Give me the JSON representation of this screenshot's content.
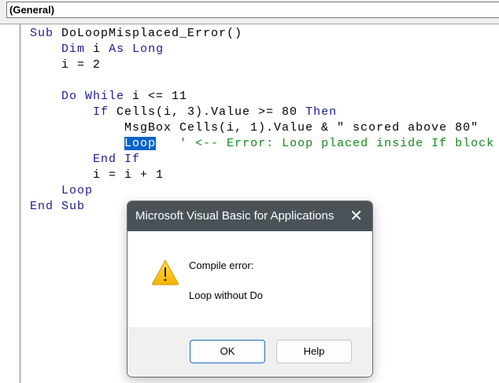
{
  "procedure_combo": "(General)",
  "code_lines": [
    [
      {
        "t": "Sub ",
        "c": "kw"
      },
      {
        "t": "DoLoopMisplaced_Error()",
        "c": ""
      }
    ],
    [
      {
        "t": "    Dim i As Long",
        "c": "kw2"
      }
    ],
    [
      {
        "t": "    i = 2",
        "c": ""
      }
    ],
    [
      {
        "t": "",
        "c": ""
      }
    ],
    [
      {
        "t": "    Do While",
        "c": "kw"
      },
      {
        "t": " i <= 11",
        "c": ""
      }
    ],
    [
      {
        "t": "        If",
        "c": "kw"
      },
      {
        "t": " Cells(i, 3).Value >= 80 ",
        "c": ""
      },
      {
        "t": "Then",
        "c": "kw"
      }
    ],
    [
      {
        "t": "            MsgBox Cells(i, 1).Value & \" scored above 80\"",
        "c": ""
      }
    ],
    [
      {
        "t": "            ",
        "c": ""
      },
      {
        "t": "Loop",
        "c": "hl"
      },
      {
        "t": "   ' <-- Error: Loop placed inside If block",
        "c": "cm"
      }
    ],
    [
      {
        "t": "        End If",
        "c": "kw"
      }
    ],
    [
      {
        "t": "        i = i + 1",
        "c": ""
      }
    ],
    [
      {
        "t": "    Loop",
        "c": "kw"
      }
    ],
    [
      {
        "t": "End Sub",
        "c": "kw"
      }
    ]
  ],
  "dialog": {
    "title": "Microsoft Visual Basic for Applications",
    "message_title": "Compile error:",
    "message": "Loop without Do",
    "ok_label": "OK",
    "help_label": "Help",
    "close_icon": "close-icon",
    "warning_icon": "warning-icon"
  }
}
